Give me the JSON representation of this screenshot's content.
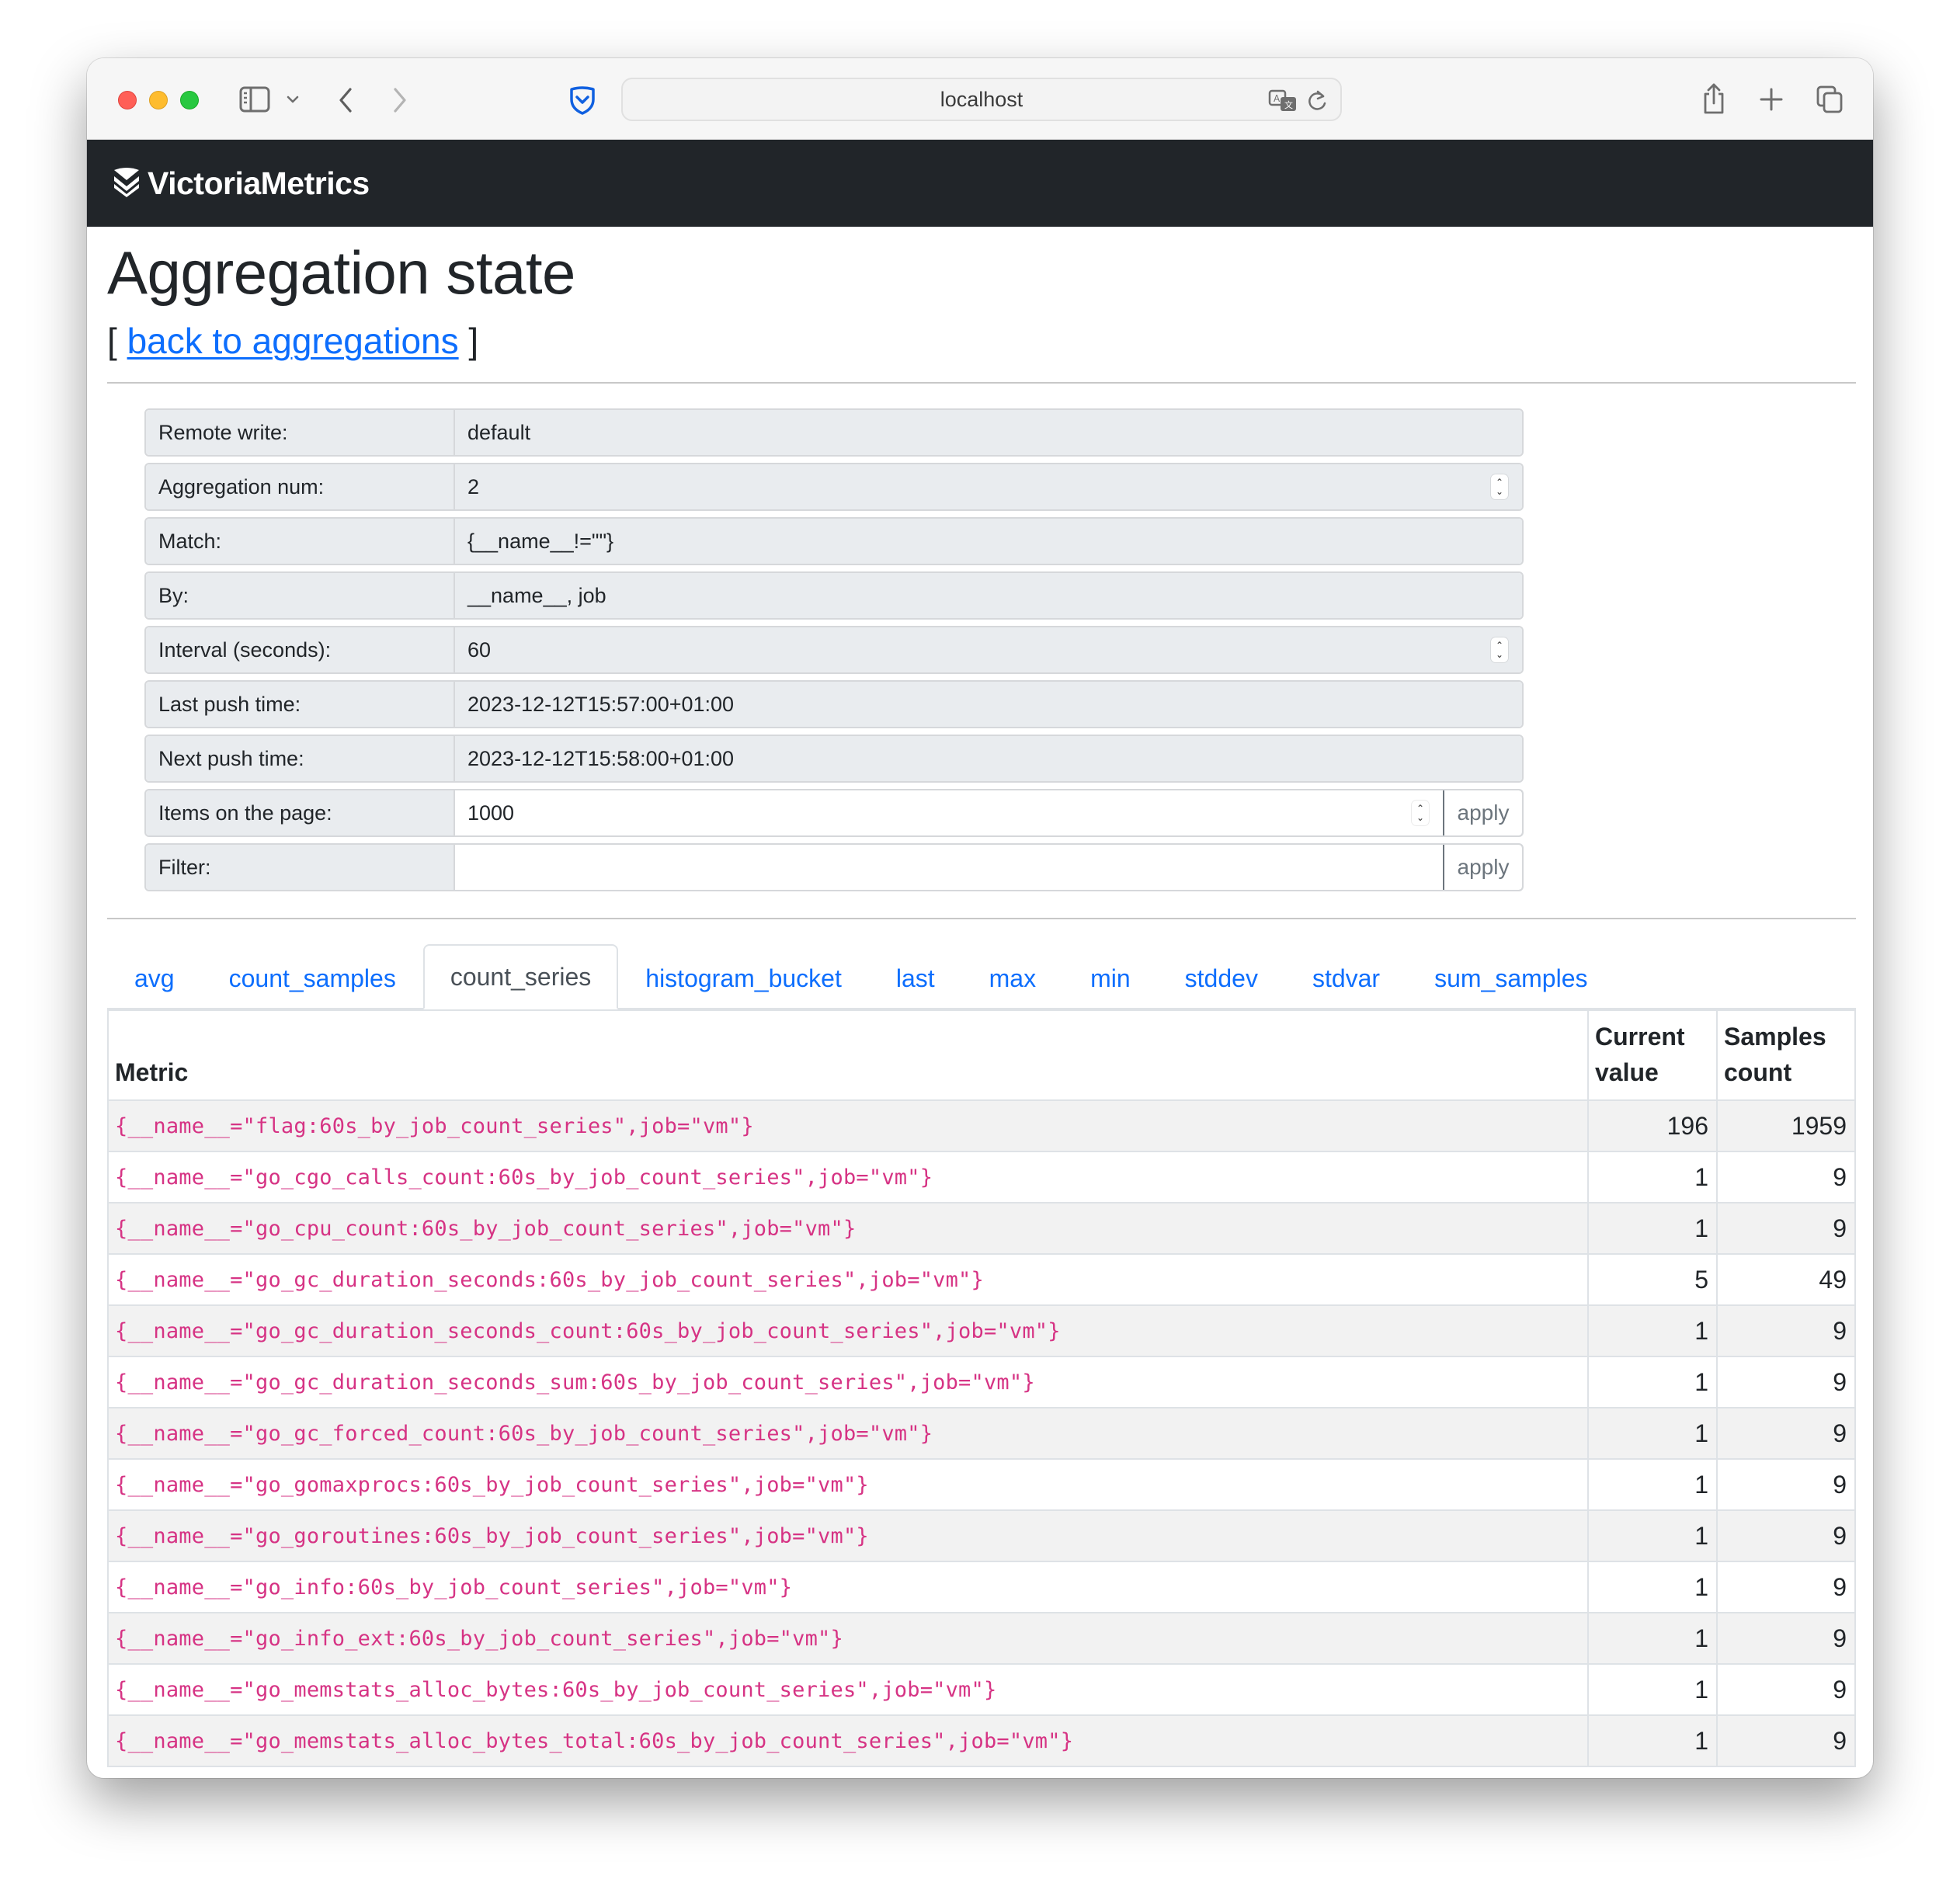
{
  "browser": {
    "url": "localhost",
    "icons": {
      "sidebar": "sidebar-toggle-icon",
      "sidebar_menu": "chevron-down-icon",
      "back": "chevron-left-icon",
      "forward": "chevron-right-icon",
      "privacy": "shield-icon",
      "translate": "translate-icon",
      "reload": "reload-icon",
      "share": "share-icon",
      "new_tab": "plus-icon",
      "tabs_overview": "tabs-icon"
    }
  },
  "navbar": {
    "brand": "VictoriaMetrics",
    "logo_icon": "victoriametrics-logo-icon"
  },
  "page": {
    "title": "Aggregation state",
    "back_prefix": "[",
    "back_link": "back to aggregations",
    "back_suffix": "]"
  },
  "form": {
    "rows": [
      {
        "label": "Remote write:",
        "value": "default"
      },
      {
        "label": "Aggregation num:",
        "value": "2"
      },
      {
        "label": "Match:",
        "value": "{__name__!=\"\"}"
      },
      {
        "label": "By:",
        "value": "__name__, job"
      },
      {
        "label": "Interval (seconds):",
        "value": "60"
      },
      {
        "label": "Last push time:",
        "value": "2023-12-12T15:57:00+01:00"
      },
      {
        "label": "Next push time:",
        "value": "2023-12-12T15:58:00+01:00"
      }
    ],
    "items_label": "Items on the page:",
    "items_value": "1000",
    "filter_label": "Filter:",
    "filter_value": "",
    "apply_label": "apply"
  },
  "tabs": [
    {
      "label": "avg",
      "active": false
    },
    {
      "label": "count_samples",
      "active": false
    },
    {
      "label": "count_series",
      "active": true
    },
    {
      "label": "histogram_bucket",
      "active": false
    },
    {
      "label": "last",
      "active": false
    },
    {
      "label": "max",
      "active": false
    },
    {
      "label": "min",
      "active": false
    },
    {
      "label": "stddev",
      "active": false
    },
    {
      "label": "stdvar",
      "active": false
    },
    {
      "label": "sum_samples",
      "active": false
    }
  ],
  "table": {
    "headers": {
      "metric": "Metric",
      "current_value_1": "Current",
      "current_value_2": "value",
      "samples_count_1": "Samples",
      "samples_count_2": "count"
    },
    "rows": [
      {
        "metric": "{__name__=\"flag:60s_by_job_count_series\",job=\"vm\"}",
        "current": "196",
        "samples": "1959"
      },
      {
        "metric": "{__name__=\"go_cgo_calls_count:60s_by_job_count_series\",job=\"vm\"}",
        "current": "1",
        "samples": "9"
      },
      {
        "metric": "{__name__=\"go_cpu_count:60s_by_job_count_series\",job=\"vm\"}",
        "current": "1",
        "samples": "9"
      },
      {
        "metric": "{__name__=\"go_gc_duration_seconds:60s_by_job_count_series\",job=\"vm\"}",
        "current": "5",
        "samples": "49"
      },
      {
        "metric": "{__name__=\"go_gc_duration_seconds_count:60s_by_job_count_series\",job=\"vm\"}",
        "current": "1",
        "samples": "9"
      },
      {
        "metric": "{__name__=\"go_gc_duration_seconds_sum:60s_by_job_count_series\",job=\"vm\"}",
        "current": "1",
        "samples": "9"
      },
      {
        "metric": "{__name__=\"go_gc_forced_count:60s_by_job_count_series\",job=\"vm\"}",
        "current": "1",
        "samples": "9"
      },
      {
        "metric": "{__name__=\"go_gomaxprocs:60s_by_job_count_series\",job=\"vm\"}",
        "current": "1",
        "samples": "9"
      },
      {
        "metric": "{__name__=\"go_goroutines:60s_by_job_count_series\",job=\"vm\"}",
        "current": "1",
        "samples": "9"
      },
      {
        "metric": "{__name__=\"go_info:60s_by_job_count_series\",job=\"vm\"}",
        "current": "1",
        "samples": "9"
      },
      {
        "metric": "{__name__=\"go_info_ext:60s_by_job_count_series\",job=\"vm\"}",
        "current": "1",
        "samples": "9"
      },
      {
        "metric": "{__name__=\"go_memstats_alloc_bytes:60s_by_job_count_series\",job=\"vm\"}",
        "current": "1",
        "samples": "9"
      },
      {
        "metric": "{__name__=\"go_memstats_alloc_bytes_total:60s_by_job_count_series\",job=\"vm\"}",
        "current": "1",
        "samples": "9"
      }
    ]
  },
  "colors": {
    "navbar_bg": "#212529",
    "link": "#0d6efd",
    "metric_text": "#d63384",
    "active_tab_text": "#495057",
    "row_stripe": "#f2f2f2"
  }
}
